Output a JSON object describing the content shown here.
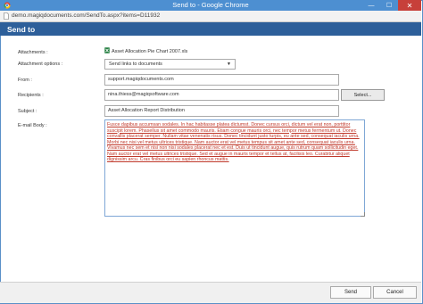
{
  "window": {
    "title": "Send to - Google Chrome",
    "url": "demo.magiqdocuments.com/SendTo.aspx?items=D11932",
    "minimize_glyph": "—",
    "maximize_glyph": "☐",
    "close_glyph": "✕"
  },
  "dialog": {
    "title": "Send to"
  },
  "form": {
    "attachments_label": "Attachments :",
    "attachment_file": "Asset Allocation Pie Chart 2007.xls",
    "attachment_options_label": "Attachment options :",
    "attachment_option_selected": "Send links to documents",
    "from_label": "From :",
    "from_value": "support.magiqdocuments.com",
    "recipients_label": "Recipients :",
    "recipients_value": "nina.thiess@magiqsoftware.com",
    "select_button": "Select...",
    "subject_label": "Subject :",
    "subject_value": "Asset Allocation Report Distribution",
    "body_label": "E-mail Body :",
    "body_text": "Fusce dapibus accumsan sodales. In hac habitasse platea dictumst. Donec cursus orci, dictum vel erat non, porttitor suscipit lorem. Phasellus sit amet commodo mauris. Etiam congue mauris orci, nec tempor metus fermentum ut. Donec convallis placerat semper. Nullam vitae venenatis risus. Donec tincidunt justo turpis, eu ante sed, consequat iaculis urna. Morbi nec nisi vel metus ultrices tristique. Nam auctor erat vel metus tempus sit amet ante sed, consequat iaculis urna. Vivamus nec sem et nisi non nisi sodales placerat nec et est. Duis ut tincidunt augue, quis rutrum quam sollicitudin eget. Nam auctor erat vel metus ultrices tristique. Sed et augue in mauris tempor et tellus at, facilisis leo. Curabitur aliquet dignissim arcu. Cras finibus orci eu sapien rhoncus mattis."
  },
  "footer": {
    "send_button": "Send",
    "cancel_button": "Cancel"
  },
  "colors": {
    "titlebar": "#4d8fd1",
    "header": "#2d5f9a",
    "close": "#c7403a",
    "link_text": "#c0392b"
  }
}
